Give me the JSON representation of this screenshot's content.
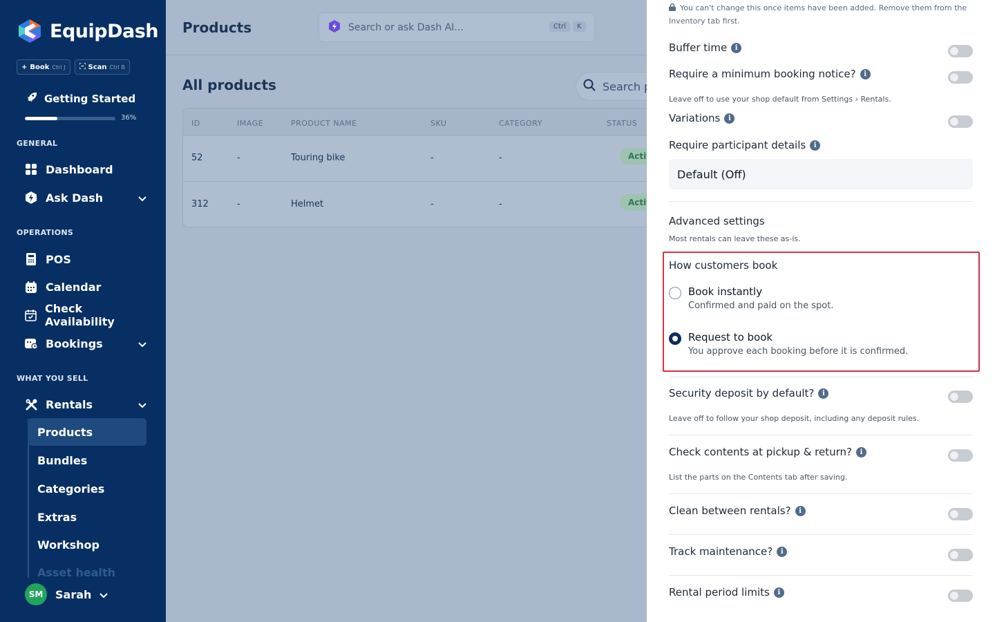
{
  "sidebar": {
    "brand": "EquipDash",
    "quick_actions": [
      {
        "label": "Book",
        "shortcut": "Ctrl J"
      },
      {
        "label": "Scan",
        "shortcut": "Ctrl B"
      }
    ],
    "getting_started": {
      "label": "Getting Started",
      "progress": 0.36,
      "progress_label": "36%"
    },
    "sections": {
      "general": "GENERAL",
      "operations": "OPERATIONS",
      "what_you_sell": "WHAT YOU SELL"
    },
    "items": {
      "dashboard": "Dashboard",
      "ask_dash": "Ask Dash",
      "pos": "POS",
      "calendar": "Calendar",
      "check_availability": "Check Availability",
      "bookings": "Bookings",
      "rentals": "Rentals"
    },
    "sub_items": [
      "Products",
      "Bundles",
      "Categories",
      "Extras",
      "Workshop",
      "Asset health"
    ],
    "user": {
      "initials": "SM",
      "name": "Sarah"
    },
    "colors": {
      "background": "#072f63",
      "active": "#1f4a7f",
      "avatar": "#22a45d"
    }
  },
  "header": {
    "title": "Products",
    "search_placeholder": "Search or ask Dash AI...",
    "shortcut_keys": [
      "Ctrl",
      "K"
    ]
  },
  "products": {
    "title": "All products",
    "search_placeholder": "Search p",
    "columns": [
      "ID",
      "IMAGE",
      "PRODUCT NAME",
      "SKU",
      "CATEGORY",
      "STATUS"
    ],
    "rows": [
      {
        "id": "52",
        "image": "-",
        "name": "Touring bike",
        "sku": "-",
        "category": "-",
        "status": "Activ"
      },
      {
        "id": "312",
        "image": "-",
        "name": "Helmet",
        "sku": "-",
        "category": "-",
        "status": "Activ"
      }
    ]
  },
  "panel": {
    "locked_note": "You can't change this once items have been added. Remove them from the Inventory tab first.",
    "buffer_time": "Buffer time",
    "min_notice": "Require a minimum booking notice?",
    "min_notice_help": "Leave off to use your shop default from Settings › Rentals.",
    "variations": "Variations",
    "participant_details": "Require participant details",
    "participant_value": "Default (Off)",
    "advanced_title": "Advanced settings",
    "advanced_sub": "Most rentals can leave these as-is.",
    "booking_mode": {
      "title": "How customers book",
      "options": [
        {
          "label": "Book instantly",
          "desc": "Confirmed and paid on the spot.",
          "checked": false
        },
        {
          "label": "Request to book",
          "desc": "You approve each booking before it is confirmed.",
          "checked": true
        }
      ]
    },
    "security_deposit": "Security deposit by default?",
    "security_help": "Leave off to follow your shop deposit, including any deposit rules.",
    "check_contents": "Check contents at pickup & return?",
    "check_contents_help": "List the parts on the Contents tab after saving.",
    "clean_between": "Clean between rentals?",
    "track_maintenance": "Track maintenance?",
    "rental_limits": "Rental period limits",
    "highlight_color": "#d9303e"
  }
}
